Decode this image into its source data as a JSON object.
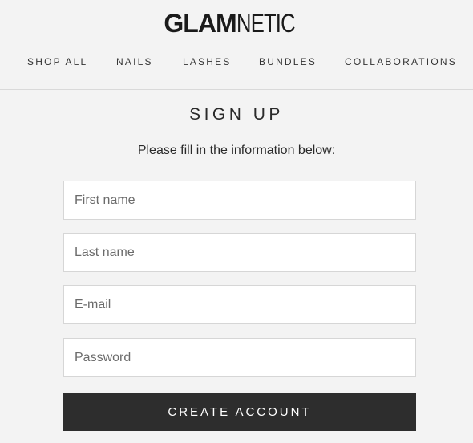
{
  "brand": {
    "logo_bold": "GLAM",
    "logo_light": "NETIC"
  },
  "nav": {
    "items": [
      {
        "label": "SHOP ALL"
      },
      {
        "label": "NAILS"
      },
      {
        "label": "LASHES"
      },
      {
        "label": "BUNDLES"
      },
      {
        "label": "COLLABORATIONS"
      }
    ]
  },
  "form": {
    "title": "SIGN UP",
    "subtitle": "Please fill in the information below:",
    "fields": {
      "first_name": {
        "placeholder": "First name",
        "value": ""
      },
      "last_name": {
        "placeholder": "Last name",
        "value": ""
      },
      "email": {
        "placeholder": "E-mail",
        "value": ""
      },
      "password": {
        "placeholder": "Password",
        "value": ""
      }
    },
    "submit_label": "CREATE ACCOUNT"
  },
  "colors": {
    "background": "#f3f3f3",
    "button_bg": "#2d2d2d",
    "button_text": "#ffffff",
    "border": "#d6d6d6",
    "text": "#2a2a2a"
  }
}
